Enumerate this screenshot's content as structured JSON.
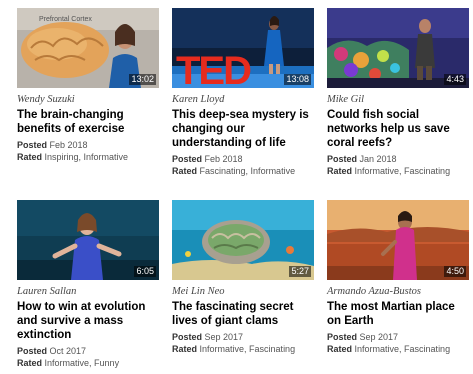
{
  "talks": [
    {
      "speaker": "Wendy Suzuki",
      "title": "The brain-changing benefits of exercise",
      "duration": "13:02",
      "posted_label": "Posted",
      "posted": "Feb 2018",
      "rated_label": "Rated",
      "rated": "Inspiring, Informative"
    },
    {
      "speaker": "Karen Lloyd",
      "title": "This deep-sea mystery is changing our understanding of life",
      "duration": "13:08",
      "posted_label": "Posted",
      "posted": "Feb 2018",
      "rated_label": "Rated",
      "rated": "Fascinating, Informative",
      "thumb_text": "TED"
    },
    {
      "speaker": "Mike Gil",
      "title": "Could fish social networks help us save coral reefs?",
      "duration": "4:43",
      "posted_label": "Posted",
      "posted": "Jan 2018",
      "rated_label": "Rated",
      "rated": "Informative, Fascinating"
    },
    {
      "speaker": "Lauren Sallan",
      "title": "How to win at evolution and survive a mass extinction",
      "duration": "6:05",
      "posted_label": "Posted",
      "posted": "Oct 2017",
      "rated_label": "Rated",
      "rated": "Informative, Funny"
    },
    {
      "speaker": "Mei Lin Neo",
      "title": "The fascinating secret lives of giant clams",
      "duration": "5:27",
      "posted_label": "Posted",
      "posted": "Sep 2017",
      "rated_label": "Rated",
      "rated": "Informative, Fascinating"
    },
    {
      "speaker": "Armando Azua-Bustos",
      "title": "The most Martian place on Earth",
      "duration": "4:50",
      "posted_label": "Posted",
      "posted": "Sep 2017",
      "rated_label": "Rated",
      "rated": "Informative, Fascinating"
    }
  ],
  "colors": {
    "ted_red": "#e62b1e",
    "duration_bg": "#000000",
    "stage_blue": "#1565c0"
  }
}
